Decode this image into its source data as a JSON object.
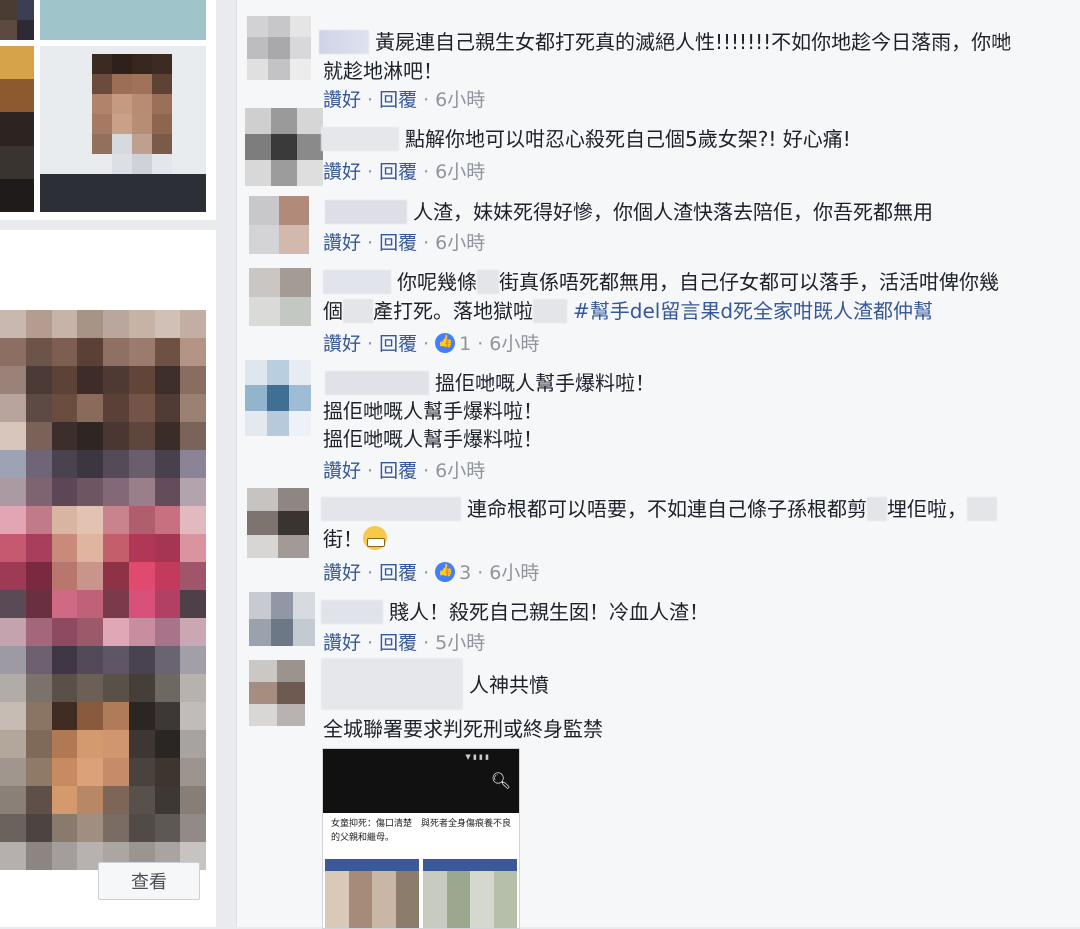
{
  "left": {
    "see_button": "查看"
  },
  "comments": [
    {
      "text_parts": [
        "黃屍連自己親生女都打死真的滅絕人性!!!!!!!不如你地趁今日落雨，你哋"
      ],
      "line2": "就趁地淋吧！",
      "actions": {
        "like": "讚好",
        "reply": "回覆",
        "time": "6小時"
      }
    },
    {
      "text": "點解你地可以咁忍心殺死自己個5歲女架?! 好心痛!",
      "actions": {
        "like": "讚好",
        "reply": "回覆",
        "time": "6小時"
      }
    },
    {
      "text": "人渣，妹妹死得好慘，你個人渣快落去陪佢，你吾死都無用",
      "actions": {
        "like": "讚好",
        "reply": "回覆",
        "time": "6小時"
      }
    },
    {
      "line1a": "你呢幾條",
      "line1b": "街真係唔死都無用，自己仔女都可以落手，活活咁俾你幾",
      "line2a": "個",
      "line2b": "產打死。落地獄啦",
      "hashtag": "#幫手del留言果d死全家咁既人渣都仲幫",
      "actions": {
        "like": "讚好",
        "reply": "回覆",
        "likes": "1",
        "time": "6小時"
      }
    },
    {
      "lines": [
        "搵佢哋嘅人幫手爆料啦！",
        "搵佢哋嘅人幫手爆料啦！",
        "搵佢哋嘅人幫手爆料啦！"
      ],
      "actions": {
        "like": "讚好",
        "reply": "回覆",
        "time": "6小時"
      }
    },
    {
      "line1a": "連命根都可以唔要，不如連自己條子孫根都剪",
      "line1b": "埋佢啦，",
      "line2": "街！",
      "actions": {
        "like": "讚好",
        "reply": "回覆",
        "likes": "3",
        "time": "6小時"
      }
    },
    {
      "text": "賤人！殺死自己親生囡！冷血人渣！",
      "actions": {
        "like": "讚好",
        "reply": "回覆",
        "time": "5小時"
      }
    },
    {
      "line1": "人神共憤",
      "line2": "全城聯署要求判死刑或終身監禁",
      "attachment_caption": "女童抑死：傷口清楚　與死者全身傷痕養不良的父親和繼母。"
    }
  ],
  "colors": {
    "link": "#365899",
    "meta": "#90949c",
    "panel_bg": "#f6f7f9",
    "page_bg": "#e9ebee"
  }
}
